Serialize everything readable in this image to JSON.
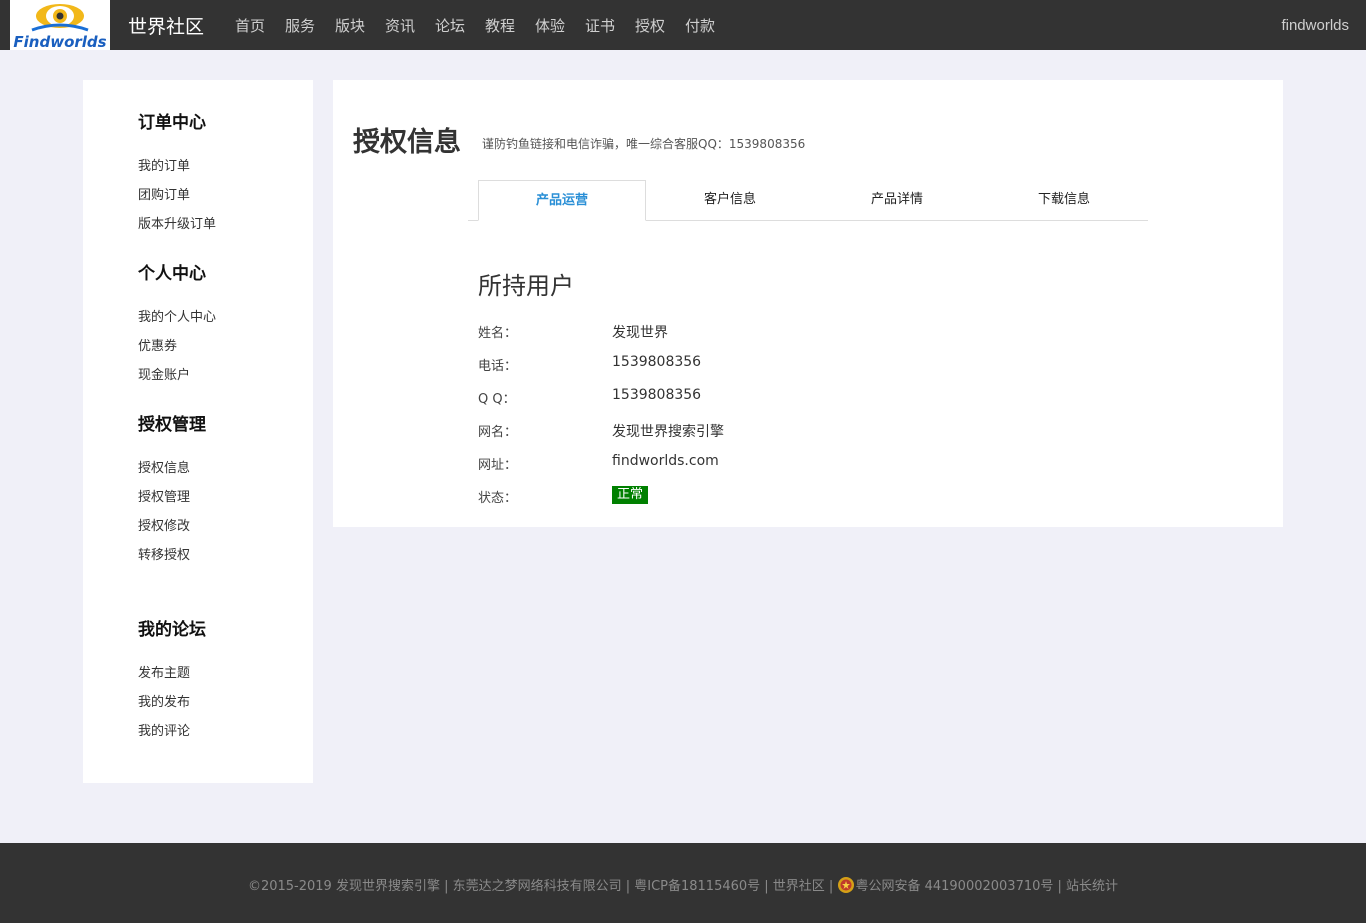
{
  "header": {
    "logo_text": "Findworlds",
    "site_title": "世界社区",
    "nav": [
      "首页",
      "服务",
      "版块",
      "资讯",
      "论坛",
      "教程",
      "体验",
      "证书",
      "授权",
      "付款"
    ],
    "brand_right": "findworlds"
  },
  "sidebar": {
    "sections": [
      {
        "heading": "订单中心",
        "links": [
          "我的订单",
          "团购订单",
          "版本升级订单"
        ]
      },
      {
        "heading": "个人中心",
        "links": [
          "我的个人中心",
          "优惠券",
          "现金账户"
        ]
      },
      {
        "heading": "授权管理",
        "links": [
          "授权信息",
          "授权管理",
          "授权修改",
          "转移授权"
        ]
      },
      {
        "heading": "我的论坛",
        "links": [
          "发布主题",
          "我的发布",
          "我的评论"
        ]
      }
    ]
  },
  "main": {
    "title": "授权信息",
    "subtitle": "谨防钓鱼链接和电信诈骗，唯一综合客服QQ：1539808356",
    "tabs": [
      {
        "label": "产品运营",
        "active": true
      },
      {
        "label": "客户信息",
        "active": false
      },
      {
        "label": "产品详情",
        "active": false
      },
      {
        "label": "下载信息",
        "active": false
      }
    ],
    "section_title": "所持用户",
    "rows": [
      {
        "label": "姓名：",
        "value": "发现世界"
      },
      {
        "label": "电话：",
        "value": "1539808356"
      },
      {
        "label": "Q Q：",
        "value": "1539808356"
      },
      {
        "label": "网名：",
        "value": "发现世界搜索引擎"
      },
      {
        "label": "网址：",
        "value": "findworlds.com"
      }
    ],
    "status": {
      "label": "状态：",
      "value": "正常",
      "color": "#008000"
    }
  },
  "footer": {
    "part1": "©2015-2019 发现世界搜索引擎 | 东莞达之梦网络科技有限公司 | 粤ICP备18115460号 | 世界社区 | ",
    "part2": "粤公网安备 44190002003710号 | 站长统计"
  },
  "colors": {
    "topbar": "#333333",
    "accent": "#2a8fd6",
    "status_green": "#008000",
    "background": "#f0f0f8"
  }
}
